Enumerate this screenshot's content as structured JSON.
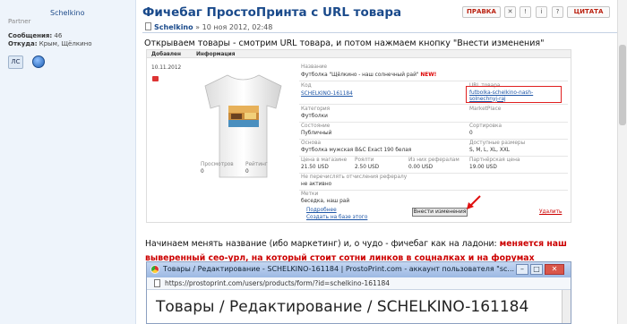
{
  "author": {
    "username": "Schelkino",
    "rank": "Partner",
    "posts_label": "Сообщения:",
    "posts_value": "46",
    "from_label": "Откуда:",
    "from_value": "Крым, Щёлкино",
    "pm_label": "ЛС"
  },
  "post": {
    "title": "Фичебаг ПростоПринта с URL товара",
    "edit_label": "ПРАВКА",
    "report_label": "✕",
    "warn_label": "!",
    "info_label": "i",
    "warn2_label": "?",
    "quote_label": "ЦИТАТА",
    "meta_author": "Schelkino",
    "meta_date": "» 10 ноя 2012, 02:48",
    "intro": "Открываем товары - смотрим URL товара, и потом нажмаем кнопку \"Внести изменения\"",
    "paragraph_plain": "Начинаем менять название (ибо маркетинг) и, о чудо - фичебаг как на ладони: ",
    "paragraph_red": "меняется наш выверенный сео-урл, на который стоит сотни линков в соцналках и на форумах"
  },
  "screenshot1": {
    "col_date": "Добавлен",
    "col_info": "Информация",
    "date": "10.11.2012",
    "name_label": "Название",
    "name_value": "Футболка \"Щёлкино - наш солнечный рай\"",
    "new_tag": "NEW!",
    "code_label": "Код",
    "code_value": "SCHELKINO-161184",
    "url_label": "URL товара",
    "url_value": "futbolka-schelkino-nash-solnechnyj-raj",
    "category_label": "Категория",
    "category_value": "Футболки",
    "marketplace_label": "MarketPlace",
    "state_label": "Состояние",
    "state_value": "Публичный",
    "sort_label": "Сортировка",
    "sort_value": "0",
    "base_label": "Основа",
    "base_value": "Футболка мужская B&C Exact 190 белая",
    "sizes_label": "Доступные размеры",
    "sizes_value": "S, M, L, XL, XXL",
    "price_label": "Цена в магазине",
    "price_value": "21.50 USD",
    "royalty_label": "Роялти",
    "royalty_value": "2.50 USD",
    "ref_label": "Из них рефералам",
    "ref_value": "0.00 USD",
    "partner_label": "Партнёрская цена",
    "partner_value": "19.00 USD",
    "noref_label": "Не перечислять отчисления рефералу",
    "noref_value": "не активно",
    "tags_label": "Метки",
    "tags_value": "беседка, наш рай",
    "views_label": "Просмотров",
    "views_value": "0",
    "rating_label": "Рейтинг",
    "rating_value": "0",
    "more_link": "Подробнее",
    "create_link": "Создать на базе этого",
    "apply_label": "Внести изменения",
    "delete_link": "Удалить"
  },
  "browser": {
    "title": "Товары / Редактирование - SCHELKINO-161184 | ProstoPrint.com - аккаунт пользователя \"sc...",
    "url": "https://prostoprint.com/users/products/form/?id=schelkino-161184",
    "heading": "Товары / Редактирование / SCHELKINO-161184",
    "min_label": "–",
    "max_label": "□",
    "close_label": "✕"
  }
}
